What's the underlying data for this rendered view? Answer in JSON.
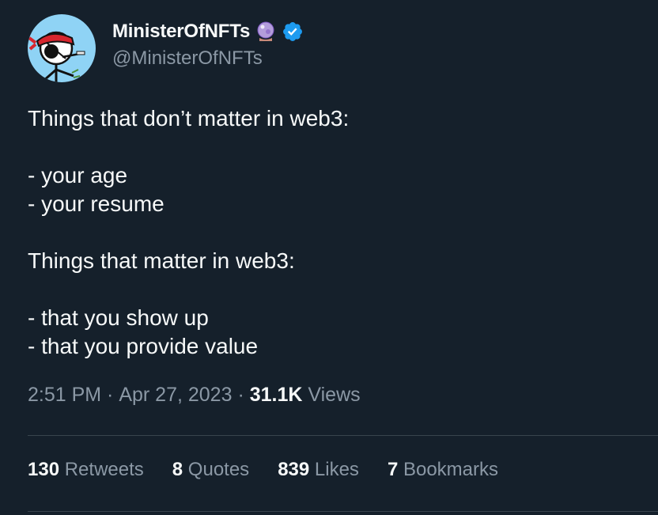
{
  "author": {
    "display_name": "MinisterOfNFTs",
    "handle": "@MinisterOfNFTs",
    "name_emoji_icon": "crystal-ball-icon",
    "verified_icon": "verified-badge-icon",
    "verified_color": "#1d9bf0"
  },
  "tweet": {
    "lines": [
      "Things that don’t matter in web3:",
      "",
      "- your age",
      "- your resume",
      "",
      "Things that matter in web3:",
      "",
      "- that you show up",
      "- that you provide value"
    ]
  },
  "meta": {
    "time": "2:51 PM",
    "separator": " · ",
    "date": "Apr 27, 2023",
    "views_count": "31.1K",
    "views_label": " Views"
  },
  "stats": {
    "retweets": {
      "count": "130",
      "label": "Retweets"
    },
    "quotes": {
      "count": "8",
      "label": "Quotes"
    },
    "likes": {
      "count": "839",
      "label": "Likes"
    },
    "bookmarks": {
      "count": "7",
      "label": "Bookmarks"
    }
  },
  "colors": {
    "background": "#15202b",
    "text_primary": "#f7f9f9",
    "text_secondary": "#8b98a5",
    "divider": "#38444d",
    "avatar_bg": "#8fd3f5"
  }
}
